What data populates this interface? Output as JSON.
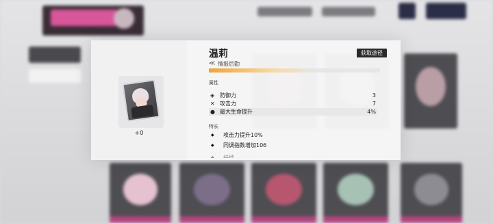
{
  "character": {
    "name": "温莉",
    "role_icon": "≪",
    "role": "情报后勤",
    "obtain_button": "获取途径",
    "rank_progress": 0.62,
    "count": "+0"
  },
  "attributes": {
    "title": "属性",
    "items": [
      {
        "icon": "shield-icon",
        "glyph": "◈",
        "label": "防御力",
        "value": "3"
      },
      {
        "icon": "crossed-swords-icon",
        "glyph": "✕",
        "label": "攻击力",
        "value": "7"
      },
      {
        "icon": "drop-icon",
        "glyph": "●",
        "label": "最大生命提升",
        "value": "4%"
      }
    ]
  },
  "specialties": {
    "title": "特长",
    "items": [
      {
        "label": "攻击力提升10%"
      },
      {
        "label": "同调指数增加106"
      },
      {
        "label": "持续"
      }
    ]
  },
  "colors": {
    "accent_orange": "#f0a339",
    "dark_button": "#2a2a2c"
  }
}
